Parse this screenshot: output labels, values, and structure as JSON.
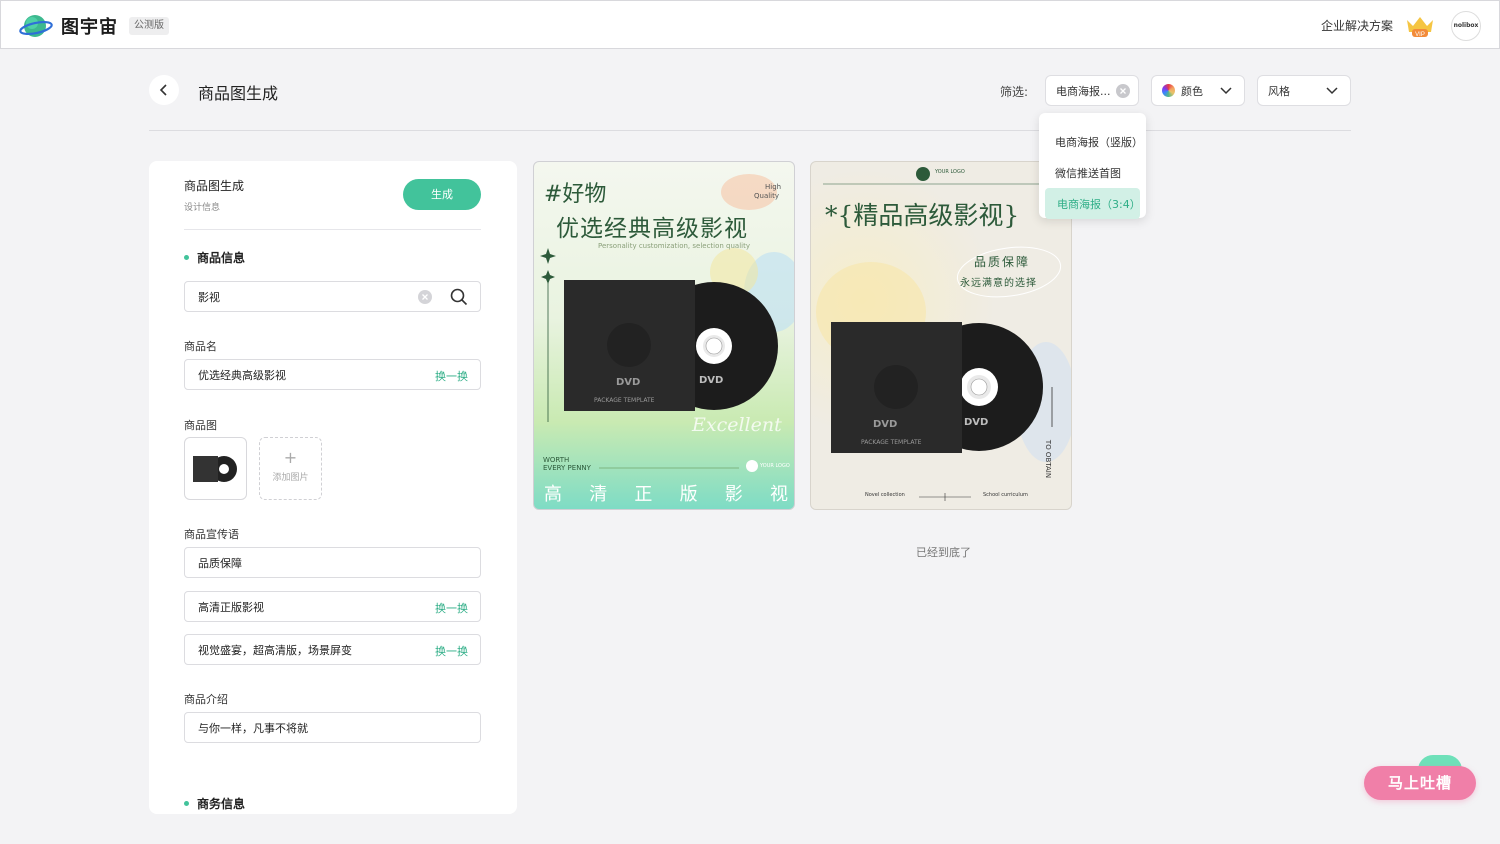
{
  "topbar": {
    "brand": "图宇宙",
    "badge": "公测版",
    "enterprise": "企业解决方案",
    "vip_label": "VIP",
    "avatar_text": "nolibox"
  },
  "header": {
    "title": "商品图生成",
    "filter_label": "筛选:",
    "filter_type_value": "电商海报...",
    "filter_color": "颜色",
    "filter_style": "风格"
  },
  "dropdown": {
    "items": [
      "电商海报（竖版）",
      "微信推送首图",
      "电商海报（3:4）"
    ],
    "selected_index": 2
  },
  "panel": {
    "title": "商品图生成",
    "subtitle": "设计信息",
    "generate": "生成",
    "section_product": "商品信息",
    "search_value": "影视",
    "name_label": "商品名",
    "name_value": "优选经典高级影视",
    "swap": "换一换",
    "image_label": "商品图",
    "add_image": "添加图片",
    "slogan_label": "商品宣传语",
    "slogans": [
      "品质保障",
      "高清正版影视",
      "视觉盛宴，超高清版，场景屏变"
    ],
    "intro_label": "商品介绍",
    "intro_value": "与你一样，凡事不将就",
    "section_business": "商务信息"
  },
  "card1": {
    "tag": "#好物",
    "hq1": "High",
    "hq2": "Quality",
    "title": "优选经典高级影视",
    "subtitle": "Personality customization, selection quality",
    "dvd1": "DVD",
    "pkg": "PACKAGE  TEMPLATE",
    "dvd2": "DVD",
    "excellent": "Excellent",
    "worth1": "WORTH",
    "worth2": "EVERY PENNY",
    "logo": "YOUR LOGO",
    "bottom": [
      "高",
      "清",
      "正",
      "版",
      "影",
      "视"
    ]
  },
  "card2": {
    "logo": "YOUR LOGO",
    "title": "*{精品高级影视}",
    "tag1": "品质保障",
    "tag2": "永远满意的选择",
    "dvd1": "DVD",
    "pkg": "PACKAGE  TEMPLATE",
    "dvd2": "DVD",
    "vertical": "TO OBTAIN",
    "footer_left": "Novel collection",
    "footer_right": "School curriculum"
  },
  "end_text": "已经到底了",
  "feedback": "马上吐槽",
  "colors": {
    "accent": "#42c39b",
    "feedback": "#f07fa8"
  }
}
